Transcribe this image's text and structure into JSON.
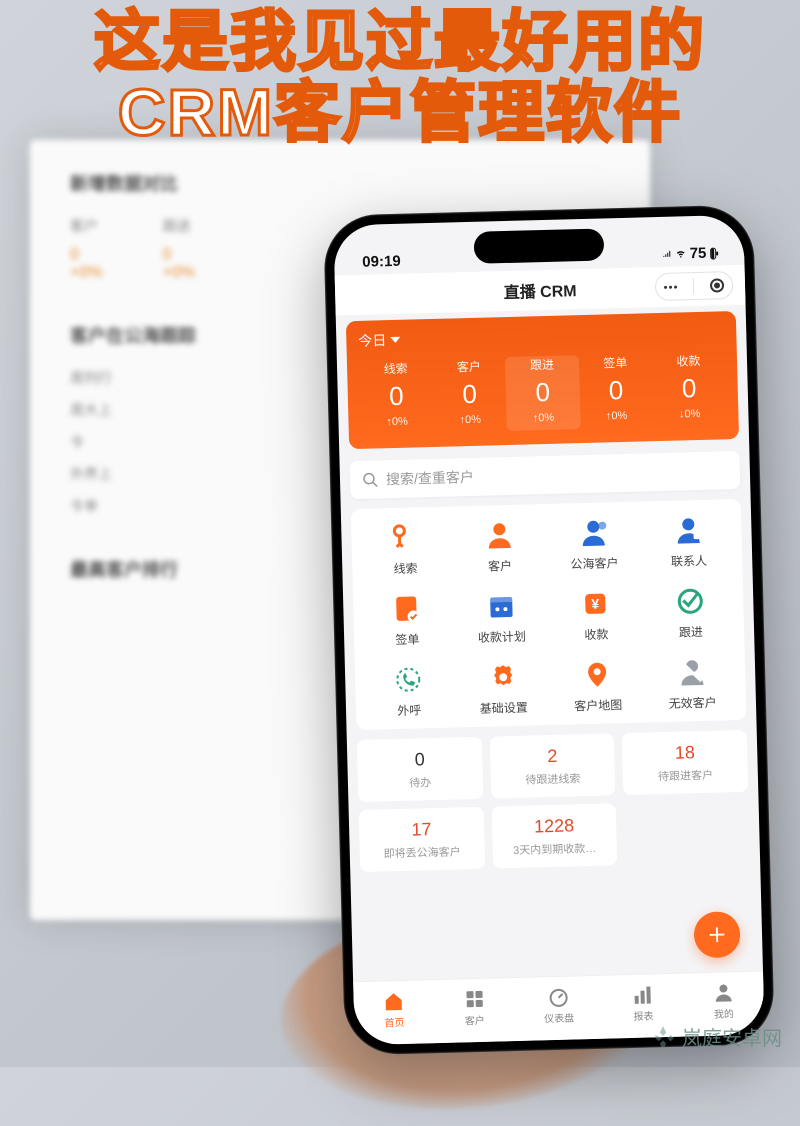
{
  "headline": {
    "line1": "这是我见过最好用的",
    "line2": "CRM客户管理软件"
  },
  "watermark_text": "岚庭安卓网",
  "bg": {
    "section1_title": "新增数据对比",
    "col1_lbl": "客户",
    "col1_val": "0",
    "col1_pct": "+0%",
    "col2_lbl": "跟进",
    "col2_val": "0",
    "col2_pct": "+0%",
    "section2_title": "客户在公海跟踪",
    "items": [
      "周列行",
      "周大上",
      "令",
      "外界上",
      "令单"
    ],
    "section3_title": "最高客户排行"
  },
  "status": {
    "time": "09:19",
    "battery": "75"
  },
  "titlebar": {
    "title": "直播 CRM"
  },
  "dash": {
    "period": "今日",
    "cols": [
      {
        "label": "线索",
        "value": "0",
        "delta": "↑0%"
      },
      {
        "label": "客户",
        "value": "0",
        "delta": "↑0%"
      },
      {
        "label": "跟进",
        "value": "0",
        "delta": "↑0%"
      },
      {
        "label": "签单",
        "value": "0",
        "delta": "↑0%"
      },
      {
        "label": "收款",
        "value": "0",
        "delta": "↓0%"
      }
    ]
  },
  "search": {
    "placeholder": "搜索/查重客户"
  },
  "menu": {
    "items": [
      {
        "key": "leads",
        "label": "线索",
        "color": "#ff6a1f"
      },
      {
        "key": "customer",
        "label": "客户",
        "color": "#ff6a1f"
      },
      {
        "key": "pool",
        "label": "公海客户",
        "color": "#2a6bd6"
      },
      {
        "key": "contact",
        "label": "联系人",
        "color": "#2a6bd6"
      },
      {
        "key": "contract",
        "label": "签单",
        "color": "#ff6a1f"
      },
      {
        "key": "payplan",
        "label": "收款计划",
        "color": "#2a6bd6"
      },
      {
        "key": "payment",
        "label": "收款",
        "color": "#ff6a1f"
      },
      {
        "key": "follow",
        "label": "跟进",
        "color": "#2aa67a"
      },
      {
        "key": "call",
        "label": "外呼",
        "color": "#2aa67a"
      },
      {
        "key": "settings",
        "label": "基础设置",
        "color": "#ff6a1f"
      },
      {
        "key": "map",
        "label": "客户地图",
        "color": "#ff6a1f"
      },
      {
        "key": "invalid",
        "label": "无效客户",
        "color": "#9aa0a6"
      }
    ]
  },
  "tasks": [
    {
      "num": "0",
      "label": "待办",
      "red": false
    },
    {
      "num": "2",
      "label": "待跟进线索",
      "red": true
    },
    {
      "num": "18",
      "label": "待跟进客户",
      "red": true
    },
    {
      "num": "17",
      "label": "即将丢公海客户",
      "red": true
    },
    {
      "num": "1228",
      "label": "3天内到期收款…",
      "red": true
    }
  ],
  "tabs": [
    {
      "key": "home",
      "label": "首页",
      "active": true
    },
    {
      "key": "customer",
      "label": "客户",
      "active": false
    },
    {
      "key": "dashboard",
      "label": "仪表盘",
      "active": false
    },
    {
      "key": "report",
      "label": "报表",
      "active": false
    },
    {
      "key": "me",
      "label": "我的",
      "active": false
    }
  ]
}
